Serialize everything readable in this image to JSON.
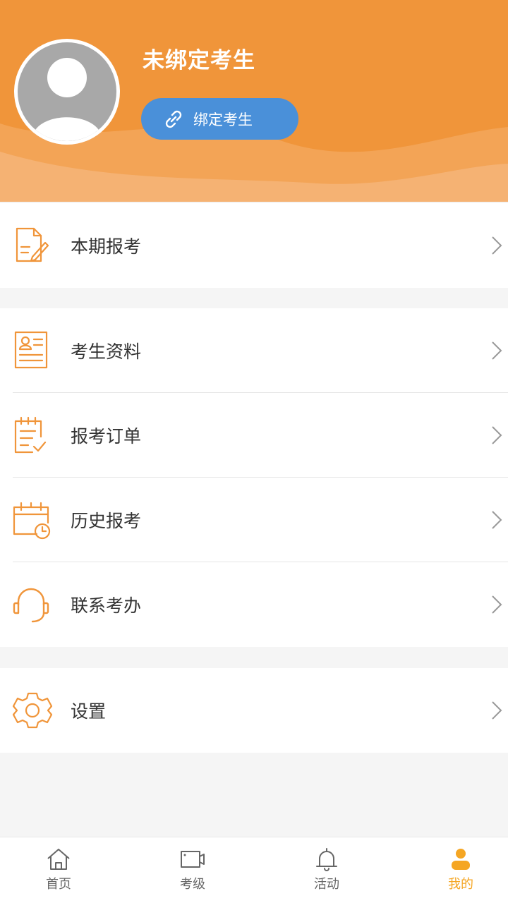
{
  "profile": {
    "name": "未绑定考生",
    "bind_button": "绑定考生"
  },
  "menu": {
    "current_registration": "本期报考",
    "candidate_info": "考生资料",
    "orders": "报考订单",
    "history": "历史报考",
    "contact": "联系考办",
    "settings": "设置"
  },
  "tabs": {
    "home": "首页",
    "grades": "考级",
    "activities": "活动",
    "mine": "我的"
  },
  "colors": {
    "header": "#f0953a",
    "accent": "#f5a623",
    "bind_button": "#4a90d9",
    "icon_orange": "#f0953a"
  },
  "icons": {
    "current_registration": "document-edit-icon",
    "candidate_info": "id-card-icon",
    "orders": "clipboard-check-icon",
    "history": "calendar-clock-icon",
    "contact": "headset-icon",
    "settings": "gear-icon",
    "bind": "link-icon",
    "home": "home-icon",
    "grades": "video-icon",
    "activities": "bell-icon",
    "mine": "user-icon"
  }
}
